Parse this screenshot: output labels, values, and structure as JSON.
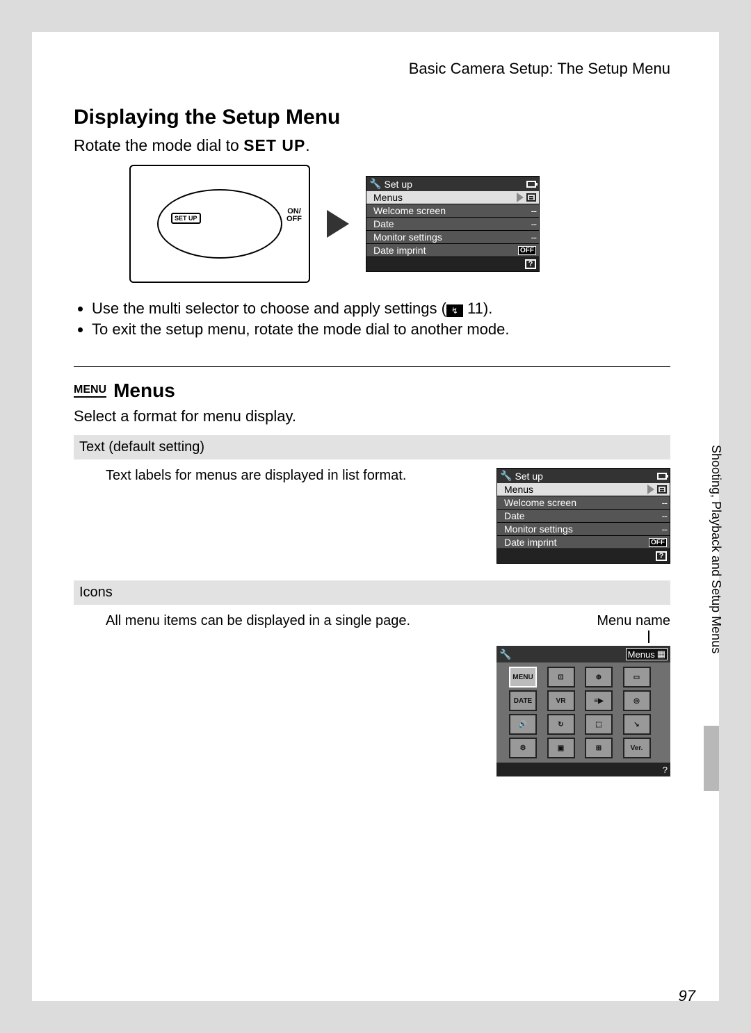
{
  "breadcrumb": "Basic Camera Setup: The Setup Menu",
  "heading1": "Displaying the Setup Menu",
  "rotate_prefix": "Rotate the mode dial to ",
  "rotate_setup": "SET UP",
  "rotate_suffix": ".",
  "dial_center": "SET UP",
  "onoff_on": "ON/",
  "onoff_off": "OFF",
  "lcd": {
    "title": "Set up",
    "rows": [
      {
        "label": "Menus",
        "val": "list",
        "selected": true
      },
      {
        "label": "Welcome screen",
        "val": "--"
      },
      {
        "label": "Date",
        "val": "--"
      },
      {
        "label": "Monitor settings",
        "val": "--"
      },
      {
        "label": "Date imprint",
        "val": "OFF"
      }
    ]
  },
  "bullet1_a": "Use the multi selector to choose and apply settings (",
  "bullet1_ref": " 11).",
  "bullet2": "To exit the setup menu, rotate the mode dial to another mode.",
  "menus_heading": "Menus",
  "menus_icon_text": "MENU",
  "menus_desc": "Select a format for menu display.",
  "opt_text_header": "Text (default setting)",
  "opt_text_body": "Text labels for menus are displayed in list format.",
  "opt_icons_header": "Icons",
  "opt_icons_body": "All menu items can be displayed in a single page.",
  "menu_name_label": "Menu name",
  "iconlcd_menuname": "Menus",
  "icon_cells": [
    "MENU",
    "⊡",
    "⊕",
    "▭",
    "DATE",
    "VR",
    "≡▶",
    "◎",
    "🔊",
    "↻",
    "⬚",
    "↘",
    "⚙",
    "▣",
    "⊞",
    "Ver."
  ],
  "side_text": "Shooting, Playback and Setup Menus",
  "page_number": "97",
  "help_q": "?"
}
